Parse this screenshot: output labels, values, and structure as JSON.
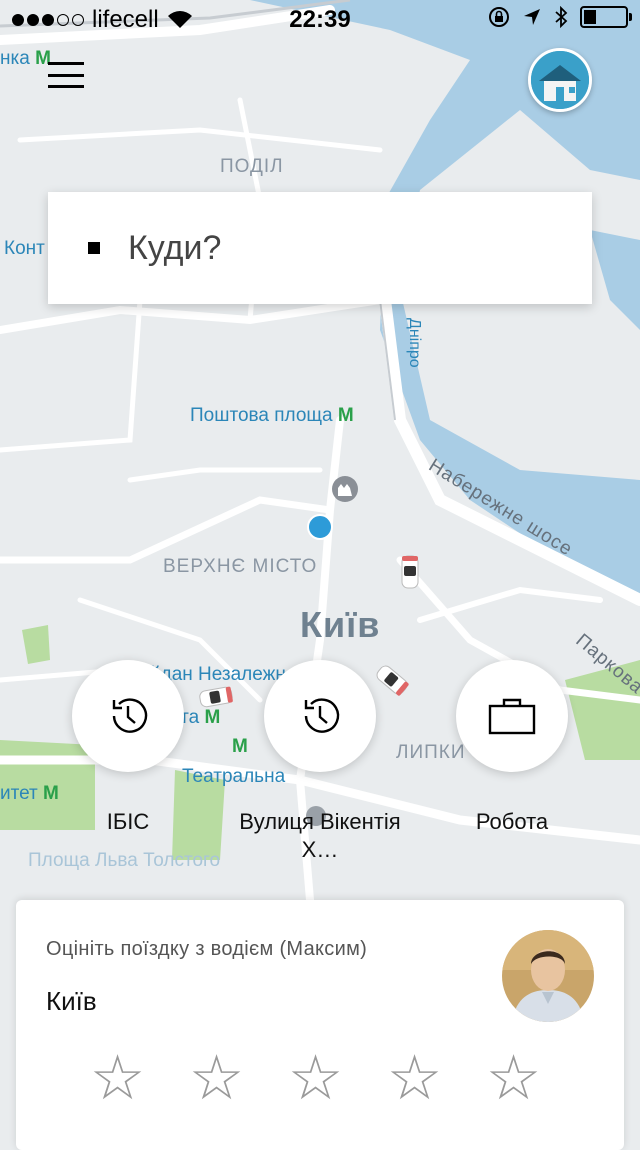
{
  "status_bar": {
    "signal_dots": 5,
    "signal_filled": 3,
    "carrier": "lifecell",
    "time": "22:39",
    "battery_level": 0.3
  },
  "header": {
    "menu_icon": "hamburger-menu-icon",
    "home_icon": "home-icon"
  },
  "search": {
    "placeholder": "Куди?"
  },
  "map": {
    "labels": {
      "podil": "ПОДІЛ",
      "kontr": "Конт",
      "nka": "нка",
      "poshtova": "Поштова площа",
      "verkhne": "ВЕРХНЄ МІСТО",
      "kyiv": "Київ",
      "naberezhne": "Набережне шосе",
      "dnipro": "Дніпро",
      "maidan": "йдан Незалежності",
      "ota": "ота",
      "teatralna": "Театральна",
      "lypky": "ЛИПКИ",
      "ytet": "итет",
      "tolstoho": "Площа Льва Толстого",
      "parkova": "Паркова"
    },
    "colors": {
      "land": "#e9ecee",
      "water": "#a9cde5",
      "road": "#ffffff",
      "park": "#b8dca1",
      "user_dot": "#2d9bd8"
    }
  },
  "shortcuts": [
    {
      "label": "ІБІС",
      "icon": "history-clock-icon"
    },
    {
      "label": "Вулиця Вікентія Х…",
      "icon": "history-clock-icon"
    },
    {
      "label": "Робота",
      "icon": "briefcase-icon"
    }
  ],
  "rating": {
    "prompt": "Оцініть поїздку з водієм (Максим)",
    "city": "Київ",
    "stars_total": 5,
    "stars_selected": 0,
    "star_icon": "star-outline-icon",
    "avatar": "driver-avatar"
  }
}
